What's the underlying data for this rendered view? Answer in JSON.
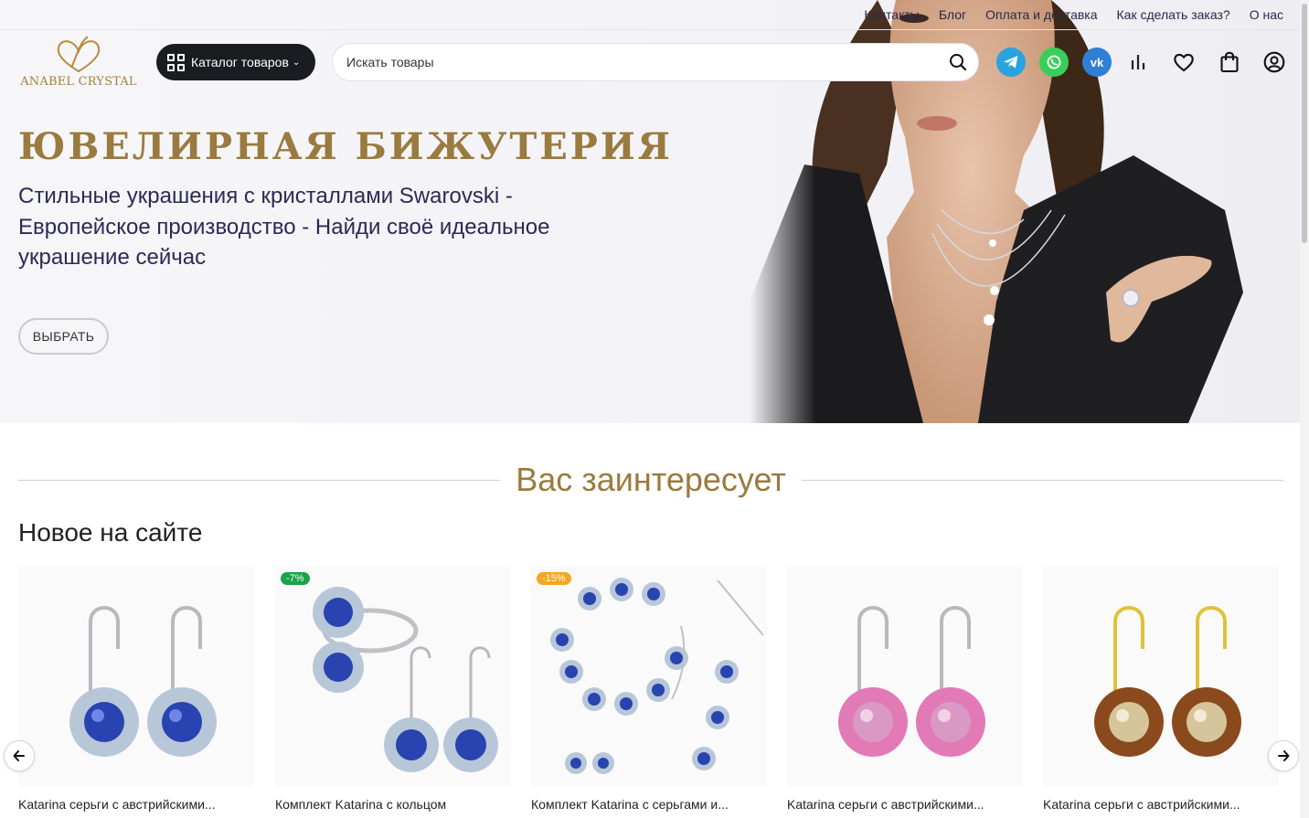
{
  "top_links": [
    "Контакты",
    "Блог",
    "Оплата и доставка",
    "Как сделать заказ?",
    "О нас"
  ],
  "logo": {
    "text": "ANABEL CRYSTAL"
  },
  "catalog_button": {
    "label": "Каталог товаров"
  },
  "search": {
    "placeholder": "Искать товары"
  },
  "header_icons": [
    "telegram-icon",
    "whatsapp-icon",
    "vk-icon",
    "compare-icon",
    "heart-icon",
    "bag-icon",
    "account-icon"
  ],
  "hero": {
    "title": "ЮВЕЛИРНАЯ БИЖУТЕРИЯ",
    "subtitle": "Стильные украшения с кристаллами Swarovski - Европейское производство - Найди своё идеальное украшение сейчас",
    "button": "ВЫБРАТЬ"
  },
  "section_title": "Вас заинтересует",
  "new_title": "Новое на сайте",
  "products": [
    {
      "name": "Katarina серьги с австрийскими...",
      "badge": ""
    },
    {
      "name": "Комплект Katarina с кольцом",
      "badge": "-7%"
    },
    {
      "name": "Комплект Katarina с серьгами и...",
      "badge": "-15%"
    },
    {
      "name": "Katarina серьги с австрийскими...",
      "badge": ""
    },
    {
      "name": "Katarina серьги с австрийскими...",
      "badge": ""
    }
  ],
  "colors": {
    "gold": "#9a7a3e",
    "badge_green": "#1aa34a",
    "badge_orange": "#f5a623",
    "telegram": "#2aa3e0",
    "whatsapp": "#37cf58",
    "vk": "#2f7fd6"
  }
}
